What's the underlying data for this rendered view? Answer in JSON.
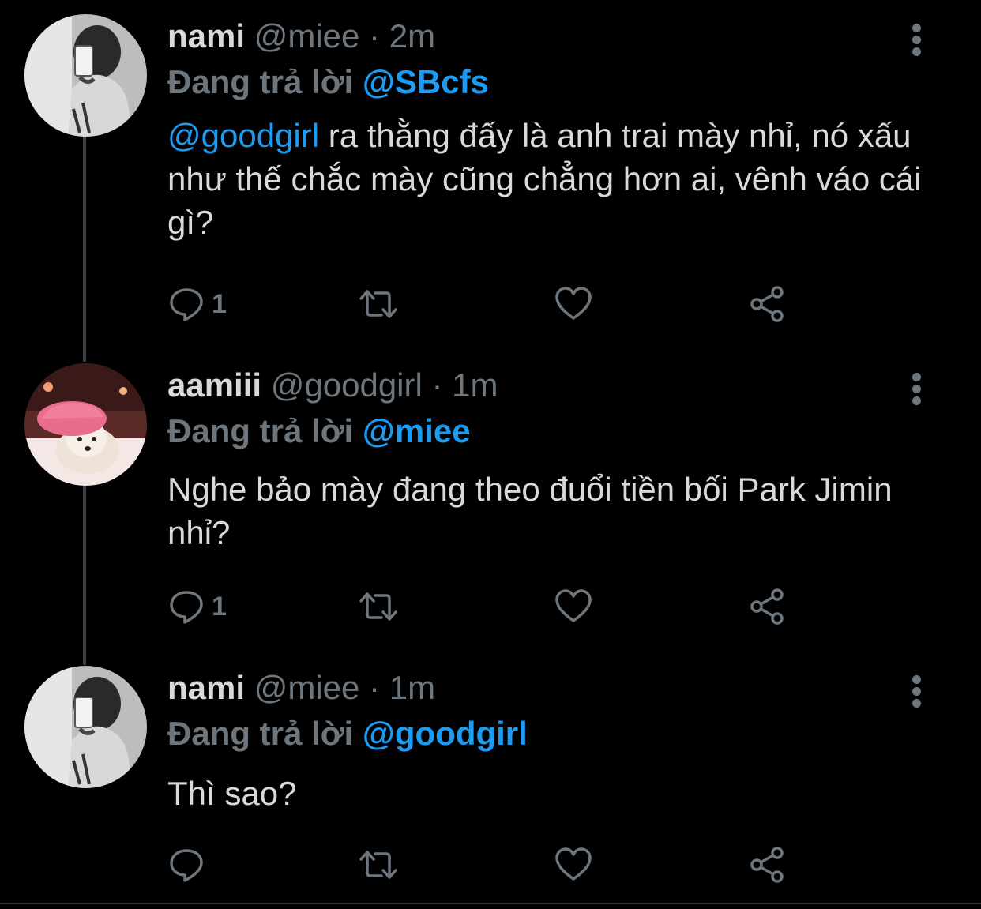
{
  "tweets": [
    {
      "name": "nami",
      "handle": "@miee",
      "separator": "·",
      "time": "2m",
      "reply_prefix": "Đang trả lời",
      "reply_target": "@SBcfs",
      "mention": "@goodgirl",
      "text": " ra thằng đấy là anh trai mày nhỉ, nó xấu như thế chắc mày cũng chẳng hơn ai, vênh váo cái gì?",
      "reply_count": "1",
      "avatar": "girl-mirror-selfie-bw"
    },
    {
      "name": "aamiii",
      "handle": "@goodgirl",
      "separator": "·",
      "time": "1m",
      "reply_prefix": "Đang trả lời",
      "reply_target": "@miee",
      "mention": "",
      "text": "Nghe bảo mày đang theo đuổi tiền bối Park Jimin nhỉ?",
      "reply_count": "1",
      "avatar": "dog-pink-shower-cap"
    },
    {
      "name": "nami",
      "handle": "@miee",
      "separator": "·",
      "time": "1m",
      "reply_prefix": "Đang trả lời",
      "reply_target": "@goodgirl",
      "mention": "",
      "text": "Thì sao?",
      "reply_count": "",
      "avatar": "girl-mirror-selfie-bw"
    }
  ],
  "icons": {
    "reply": "reply-bubble-icon",
    "retweet": "retweet-icon",
    "like": "heart-icon",
    "share": "share-icon",
    "more": "more-vertical-icon"
  },
  "colors": {
    "background": "#000000",
    "text": "#d9d9d9",
    "muted": "#6e767d",
    "accent": "#1d9bf0",
    "thread_line": "#3d4145"
  }
}
